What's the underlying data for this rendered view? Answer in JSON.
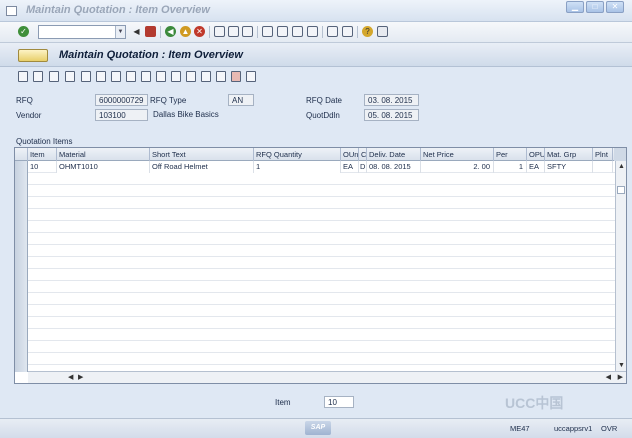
{
  "window": {
    "title": "Maintain Quotation : Item Overview"
  },
  "screen": {
    "title": "Maintain Quotation : Item Overview"
  },
  "header": {
    "rfq_label": "RFQ",
    "rfq_value": "6000000729",
    "rfq_type_label": "RFQ Type",
    "rfq_type_value": "AN",
    "rfq_date_label": "RFQ Date",
    "rfq_date_value": "03. 08. 2015",
    "vendor_label": "Vendor",
    "vendor_value": "103100",
    "vendor_name": "Dallas Bike Basics",
    "quotddln_label": "QuotDdln",
    "quotddln_value": "05. 08. 2015"
  },
  "items_section": {
    "label": "Quotation Items"
  },
  "table": {
    "columns": [
      "Item",
      "Material",
      "Short Text",
      "RFQ Quantity",
      "OUn",
      "C",
      "Deliv. Date",
      "Net Price",
      "Per",
      "OPU",
      "Mat. Grp",
      "Plnt"
    ],
    "rows": [
      {
        "item": "10",
        "material": "OHMT1010",
        "short_text": "Off Road Helmet",
        "rfq_quantity": "1",
        "oun": "EA",
        "c": "D",
        "deliv_date": "08. 08. 2015",
        "net_price": "2. 00",
        "per": "1",
        "opu": "EA",
        "mat_grp": "SFTY",
        "plnt": ""
      }
    ]
  },
  "footer": {
    "item_label": "Item",
    "item_value": "10"
  },
  "status": {
    "transaction": "ME47",
    "server": "uccappsrv1",
    "mode": "OVR"
  },
  "watermark": "UCC中国"
}
